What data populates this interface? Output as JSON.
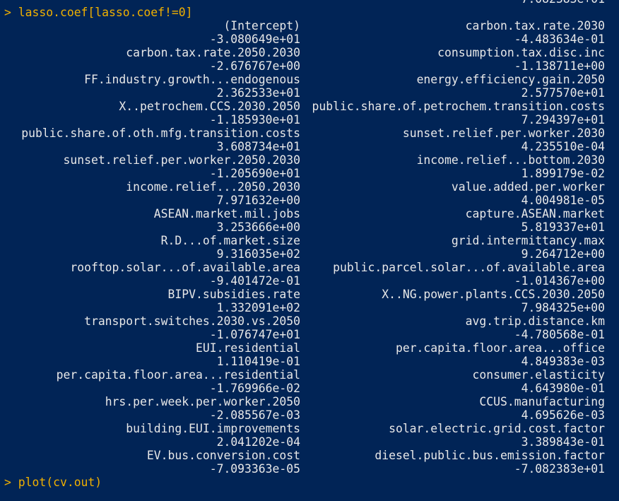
{
  "console": {
    "prior_value": "-7.082383e+01",
    "prompt_symbol": ">",
    "command": "lasso.coef[lasso.coef!=0]",
    "next_command": "plot(cv.out)",
    "pairs": [
      {
        "left_name": "(Intercept)",
        "right_name": "carbon.tax.rate.2030",
        "left_value": "-3.080649e+01",
        "right_value": "-4.483634e-01"
      },
      {
        "left_name": "carbon.tax.rate.2050.2030",
        "right_name": "consumption.tax.disc.inc",
        "left_value": "-2.676767e+00",
        "right_value": "-1.138711e+00"
      },
      {
        "left_name": "FF.industry.growth...endogenous",
        "right_name": "energy.efficiency.gain.2050",
        "left_value": "2.362533e+01",
        "right_value": "2.577570e+01"
      },
      {
        "left_name": "X..petrochem.CCS.2030.2050",
        "right_name": "public.share.of.petrochem.transition.costs",
        "left_value": "-1.185930e+01",
        "right_value": "7.294397e+01"
      },
      {
        "left_name": "public.share.of.oth.mfg.transition.costs",
        "right_name": "sunset.relief.per.worker.2030",
        "left_value": "3.608734e+01",
        "right_value": "4.235510e-04"
      },
      {
        "left_name": "sunset.relief.per.worker.2050.2030",
        "right_name": "income.relief...bottom.2030",
        "left_value": "-1.205690e+01",
        "right_value": "1.899179e-02"
      },
      {
        "left_name": "income.relief...2050.2030",
        "right_name": "value.added.per.worker",
        "left_value": "7.971632e+00",
        "right_value": "4.004981e-05"
      },
      {
        "left_name": "ASEAN.market.mil.jobs",
        "right_name": "capture.ASEAN.market",
        "left_value": "3.253666e+00",
        "right_value": "5.819337e+01"
      },
      {
        "left_name": "R.D...of.market.size",
        "right_name": "grid.intermittancy.max",
        "left_value": "9.316035e+02",
        "right_value": "9.264712e+00"
      },
      {
        "left_name": "rooftop.solar...of.available.area",
        "right_name": "public.parcel.solar...of.available.area",
        "left_value": "-9.401472e-01",
        "right_value": "-1.014367e+00"
      },
      {
        "left_name": "BIPV.subsidies.rate",
        "right_name": "X..NG.power.plants.CCS.2030.2050",
        "left_value": "1.332091e+02",
        "right_value": "7.984325e+00"
      },
      {
        "left_name": "transport.switches.2030.vs.2050",
        "right_name": "avg.trip.distance.km",
        "left_value": "-1.076747e+01",
        "right_value": "-4.780568e-01"
      },
      {
        "left_name": "EUI.residential",
        "right_name": "per.capita.floor.area...office",
        "left_value": "1.110419e-01",
        "right_value": "4.849383e-03"
      },
      {
        "left_name": "per.capita.floor.area...residential",
        "right_name": "consumer.elasticity",
        "left_value": "-1.769966e-02",
        "right_value": "4.643980e-01"
      },
      {
        "left_name": "hrs.per.week.per.worker.2050",
        "right_name": "CCUS.manufacturing",
        "left_value": "-2.085567e-03",
        "right_value": "4.695626e-03"
      },
      {
        "left_name": "building.EUI.improvements",
        "right_name": "solar.electric.grid.cost.factor",
        "left_value": "2.041202e-04",
        "right_value": "3.389843e-01"
      },
      {
        "left_name": "EV.bus.conversion.cost",
        "right_name": "diesel.public.bus.emission.factor",
        "left_value": "-7.093363e-05",
        "right_value": "-7.082383e+01"
      }
    ]
  }
}
